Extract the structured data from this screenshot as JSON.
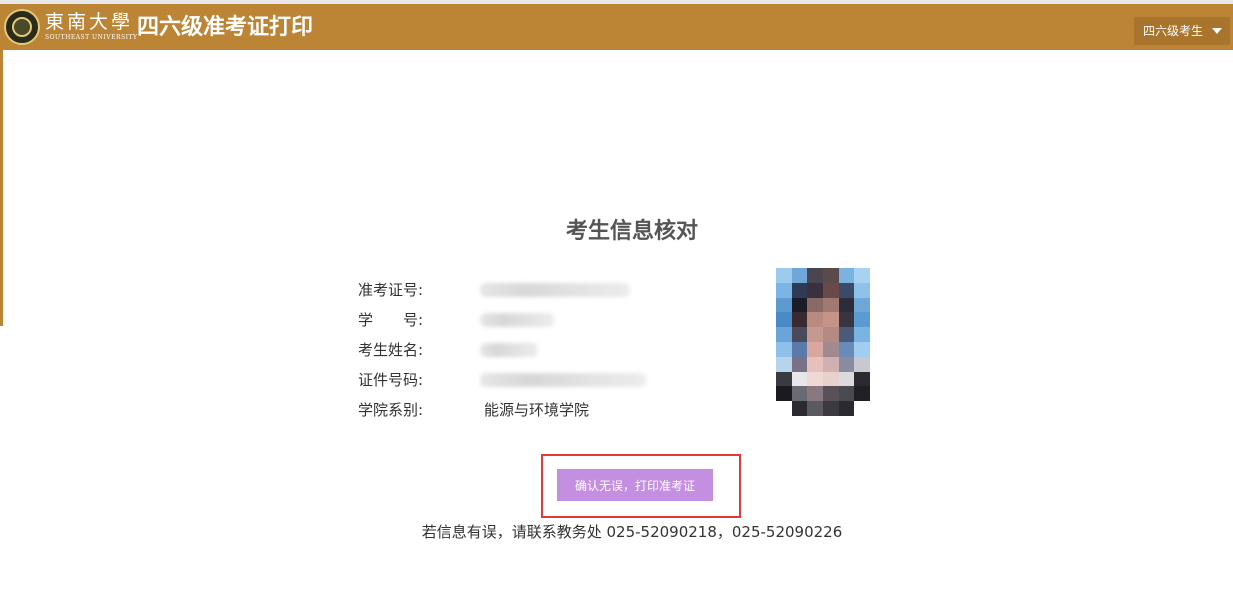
{
  "header": {
    "university_name": "東南大學",
    "university_english": "SOUTHEAST UNIVERSITY",
    "system_title": "四六级准考证打印",
    "user_menu_label": "四六级考生"
  },
  "main": {
    "heading": "考生信息核对",
    "fields": [
      {
        "label": "准考证号:",
        "value": ""
      },
      {
        "label": "学　　号:",
        "value": ""
      },
      {
        "label": "考生姓名:",
        "value": ""
      },
      {
        "label": "证件号码:",
        "value": ""
      },
      {
        "label": "学院系别:",
        "value": "能源与环境学院"
      }
    ],
    "confirm_button_label": "确认无误，打印准考证",
    "contact_note": "若信息有误，请联系教务处 025-52090218，025-52090226"
  },
  "colors": {
    "header_bg": "#bb8535",
    "button_bg": "#c48fe0",
    "highlight_border": "#e13a3a"
  },
  "icons": {
    "user_menu": "caret-down-icon",
    "logo": "university-seal-icon"
  }
}
